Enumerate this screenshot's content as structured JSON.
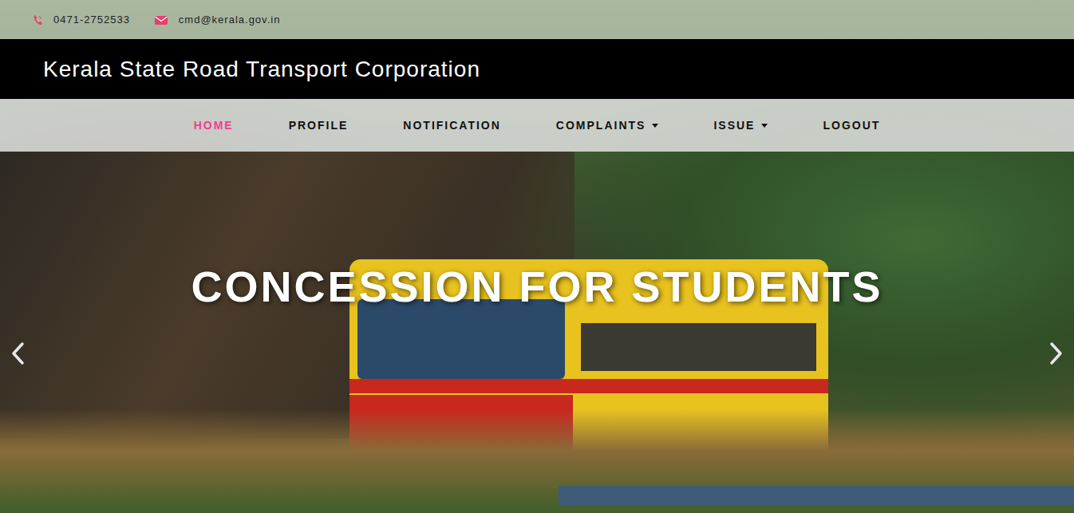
{
  "contact": {
    "phone": "0471-2752533",
    "email": "cmd@kerala.gov.in"
  },
  "brand": "Kerala State Road Transport Corporation",
  "nav": [
    {
      "label": "HOME",
      "selected": true,
      "dropdown": false
    },
    {
      "label": "PROFILE",
      "selected": false,
      "dropdown": false
    },
    {
      "label": "NOTIFICATION",
      "selected": false,
      "dropdown": false
    },
    {
      "label": "COMPLAINTS",
      "selected": false,
      "dropdown": true
    },
    {
      "label": "ISSUE",
      "selected": false,
      "dropdown": true
    },
    {
      "label": "LOGOUT",
      "selected": false,
      "dropdown": false
    }
  ],
  "carousel": {
    "caption": "CONCESSION FOR STUDENTS"
  }
}
